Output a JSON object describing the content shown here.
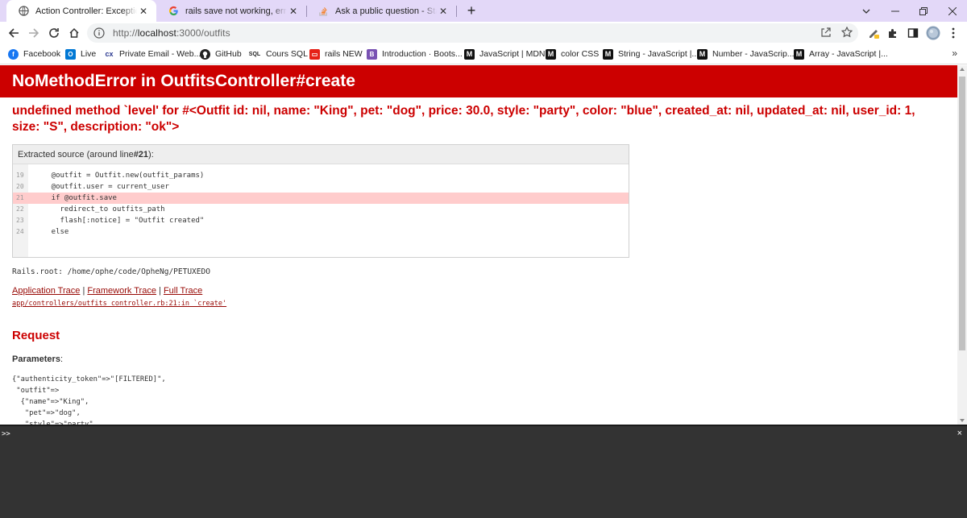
{
  "tabs": [
    {
      "title": "Action Controller: Exception caught",
      "icon": "globe-icon",
      "active": true
    },
    {
      "title": "rails save not working, error no method",
      "icon": "google-icon",
      "active": false
    },
    {
      "title": "Ask a public question - Stack Overflow",
      "icon": "stackoverflow-icon",
      "active": false
    }
  ],
  "address": {
    "scheme": "http://",
    "host": "localhost",
    "path": ":3000/outfits"
  },
  "bookmarks": [
    {
      "label": "Facebook",
      "icon": "facebook-icon",
      "color": "#1877f2"
    },
    {
      "label": "Live",
      "icon": "outlook-icon",
      "color": "#0078d4"
    },
    {
      "label": "Private Email - Web...",
      "icon": "namecheap-icon",
      "color": "#2b3990"
    },
    {
      "label": "GitHub",
      "icon": "github-icon",
      "color": "#222222"
    },
    {
      "label": "Cours SQL",
      "icon": "sql-icon",
      "color": "#222222"
    },
    {
      "label": "rails NEW",
      "icon": "youtube-icon",
      "color": "#e62117"
    },
    {
      "label": "Introduction · Boots...",
      "icon": "bootstrap-icon",
      "color": "#7952b3"
    },
    {
      "label": "JavaScript | MDN",
      "icon": "mdn-icon",
      "color": "#111111"
    },
    {
      "label": "color CSS",
      "icon": "mdn-icon",
      "color": "#111111"
    },
    {
      "label": "String - JavaScript |...",
      "icon": "mdn-icon",
      "color": "#111111"
    },
    {
      "label": "Number - JavaScrip...",
      "icon": "mdn-icon",
      "color": "#111111"
    },
    {
      "label": "Array - JavaScript |...",
      "icon": "mdn-icon",
      "color": "#111111"
    }
  ],
  "bookmarks_more": "»",
  "error": {
    "title": "NoMethodError in OutfitsController#create",
    "message": "undefined method `level' for #<Outfit id: nil, name: \"King\", pet: \"dog\", price: 30.0, style: \"party\", color: \"blue\", created_at: nil, updated_at: nil, user_id: 1, size: \"S\", description: \"ok\">"
  },
  "source": {
    "header_prefix": "Extracted source (around line ",
    "header_line": "#21",
    "header_suffix": "):",
    "lines": [
      {
        "num": "19",
        "code": "    @outfit = Outfit.new(outfit_params)",
        "highlight": false
      },
      {
        "num": "20",
        "code": "    @outfit.user = current_user",
        "highlight": false
      },
      {
        "num": "21",
        "code": "    if @outfit.save",
        "highlight": true
      },
      {
        "num": "22",
        "code": "      redirect_to outfits_path",
        "highlight": false
      },
      {
        "num": "23",
        "code": "      flash[:notice] = \"Outfit created\"",
        "highlight": false
      },
      {
        "num": "24",
        "code": "    else",
        "highlight": false
      }
    ]
  },
  "rails_root": "Rails.root: /home/ophe/code/OpheNg/PETUXEDO",
  "trace": {
    "application": "Application Trace",
    "framework": "Framework Trace",
    "full": "Full Trace",
    "sep": " | ",
    "file": "app/controllers/outfits_controller.rb:21:in `create'"
  },
  "request": {
    "title": "Request",
    "params_label": "Parameters",
    "params_colon": ":",
    "params_text": "{\"authenticity_token\"=>\"[FILTERED]\",\n \"outfit\"=>\n  {\"name\"=>\"King\",\n   \"pet\"=>\"dog\",\n   \"style\"=>\"party\","
  },
  "console": {
    "prompt": ">>",
    "close": "×"
  },
  "colors": {
    "error_red": "#cc0000",
    "tab_strip": "#e3d8f8",
    "highlight": "#ffcccc",
    "console_bg": "#333333"
  }
}
